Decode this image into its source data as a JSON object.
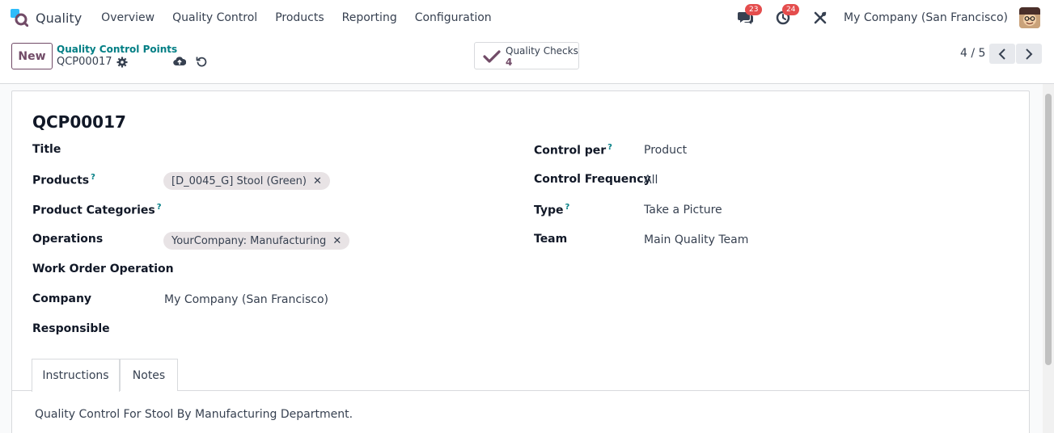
{
  "navbar": {
    "app_name": "Quality",
    "menu": [
      "Overview",
      "Quality Control",
      "Products",
      "Reporting",
      "Configuration"
    ],
    "messages_count": "23",
    "activities_count": "24",
    "company": "My Company (San Francisco)"
  },
  "control_panel": {
    "new_label": "New",
    "breadcrumb": "Quality Control Points",
    "record_name": "QCP00017",
    "smart_button": {
      "title": "Quality Checks",
      "value": "4"
    },
    "pager": "4 / 5"
  },
  "form": {
    "title": "QCP00017",
    "left": {
      "title_label": "Title",
      "products_label": "Products",
      "products_tag": "[D_0045_G] Stool (Green)",
      "product_categories_label": "Product Categories",
      "operations_label": "Operations",
      "operations_tag": "YourCompany: Manufacturing",
      "work_order_label": "Work Order Operation",
      "company_label": "Company",
      "company_value": "My Company (San Francisco)",
      "responsible_label": "Responsible"
    },
    "right": {
      "control_per_label": "Control per",
      "control_per_value": "Product",
      "control_frequency_label": "Control Frequency",
      "control_frequency_value": "All",
      "type_label": "Type",
      "type_value": "Take a Picture",
      "team_label": "Team",
      "team_value": "Main Quality Team"
    },
    "help_mark": "?",
    "tag_remove": "✕",
    "tabs": [
      "Instructions",
      "Notes"
    ],
    "instructions_text": "Quality Control For Stool By Manufacturing Department."
  },
  "colors": {
    "brand": "#714b67",
    "teal": "#017e84",
    "badge": "#e44d4d"
  }
}
